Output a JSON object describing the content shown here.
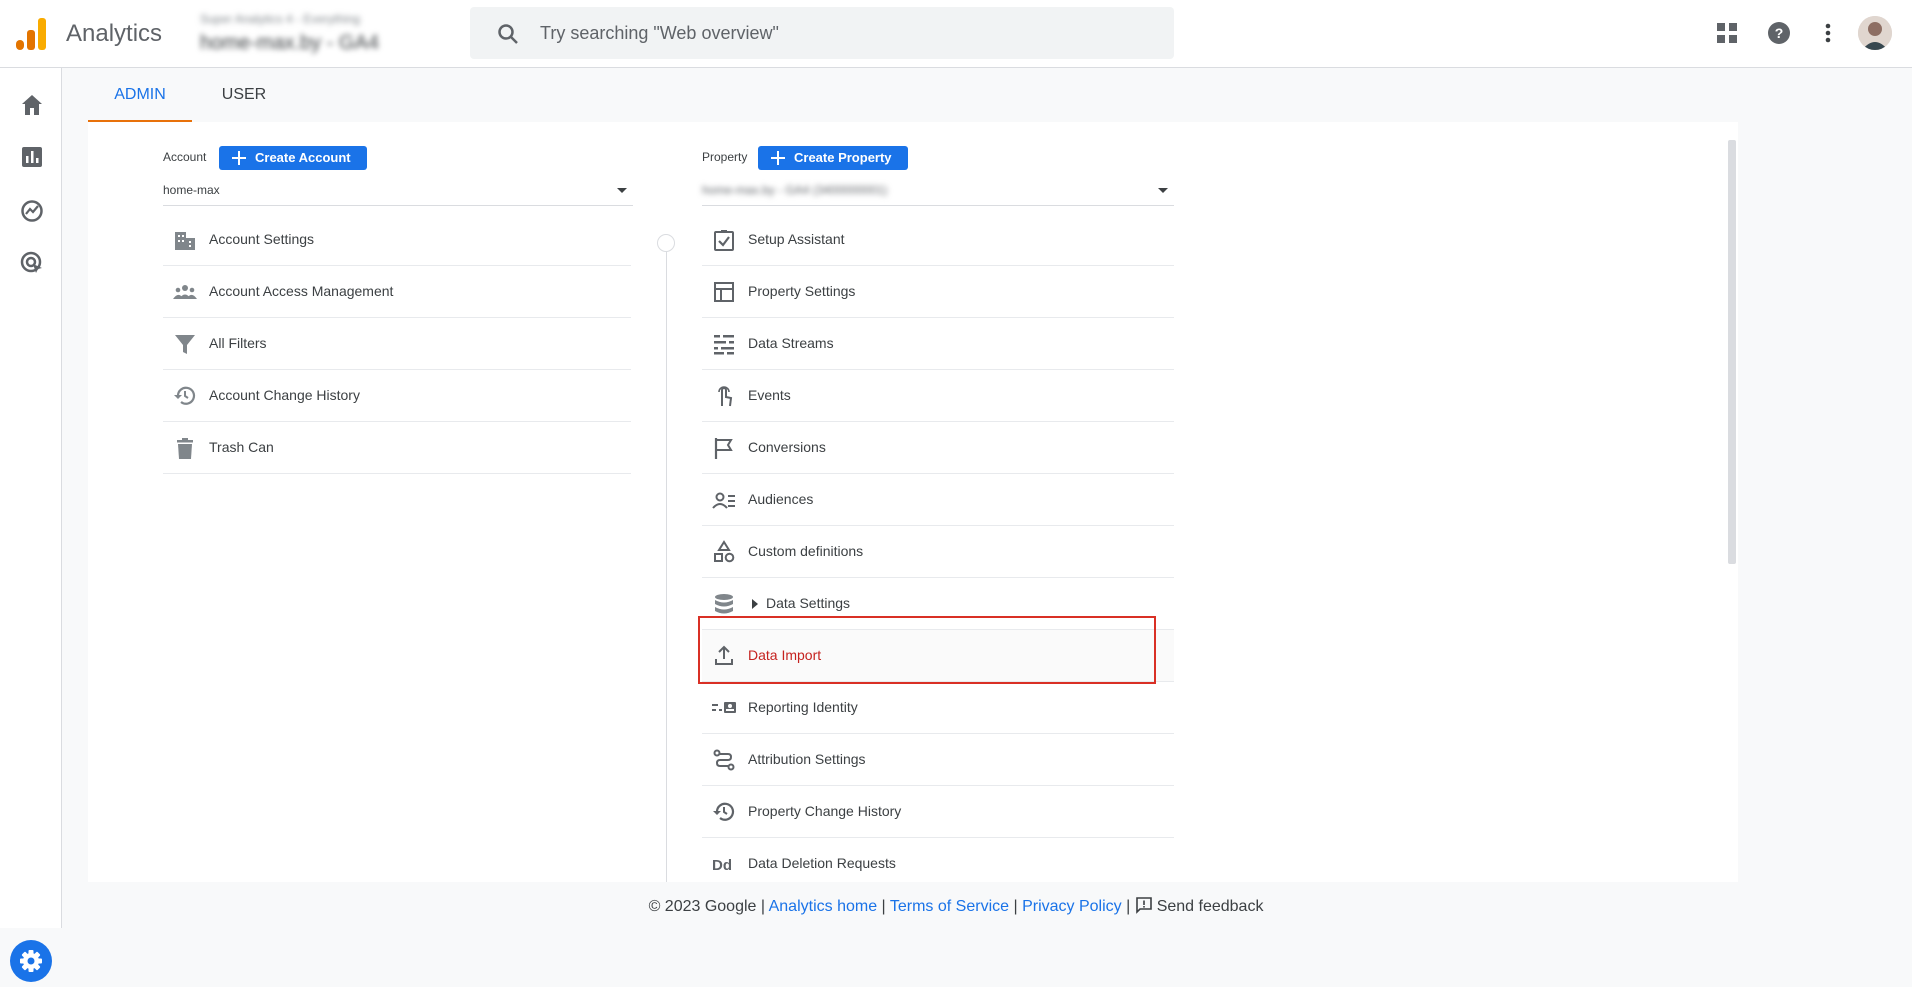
{
  "header": {
    "app_title": "Analytics",
    "property_picker": {
      "line1": "Super Analytics 4 - Everything",
      "line2": "home-max.by - GA4"
    },
    "search_placeholder": "Try searching \"Web overview\""
  },
  "tabs": [
    {
      "label": "ADMIN",
      "active": true
    },
    {
      "label": "USER",
      "active": false
    }
  ],
  "account_column": {
    "label": "Account",
    "create_button": "Create Account",
    "selected": "home-max",
    "items": [
      {
        "label": "Account Settings",
        "icon": "building-icon"
      },
      {
        "label": "Account Access Management",
        "icon": "people-icon"
      },
      {
        "label": "All Filters",
        "icon": "filter-icon"
      },
      {
        "label": "Account Change History",
        "icon": "history-icon"
      },
      {
        "label": "Trash Can",
        "icon": "trash-icon"
      }
    ]
  },
  "property_column": {
    "label": "Property",
    "create_button": "Create Property",
    "selected": "home-max.by - GA4 (3400000001)",
    "items": [
      {
        "label": "Setup Assistant",
        "icon": "checkbox-icon"
      },
      {
        "label": "Property Settings",
        "icon": "layout-icon"
      },
      {
        "label": "Data Streams",
        "icon": "streams-icon"
      },
      {
        "label": "Events",
        "icon": "touch-icon"
      },
      {
        "label": "Conversions",
        "icon": "flag-icon"
      },
      {
        "label": "Audiences",
        "icon": "audience-icon"
      },
      {
        "label": "Custom definitions",
        "icon": "shapes-icon"
      },
      {
        "label": "Data Settings",
        "icon": "database-icon"
      },
      {
        "label": "Data Import",
        "icon": "upload-icon",
        "highlighted": true
      },
      {
        "label": "Reporting Identity",
        "icon": "identity-icon"
      },
      {
        "label": "Attribution Settings",
        "icon": "attribution-icon"
      },
      {
        "label": "Property Change History",
        "icon": "history-icon"
      },
      {
        "label": "Data Deletion Requests",
        "icon": "dd-icon"
      }
    ]
  },
  "footer": {
    "copyright": "© 2023 Google",
    "links": [
      "Analytics home",
      "Terms of Service",
      "Privacy Policy"
    ],
    "feedback": "Send feedback"
  },
  "colors": {
    "accent": "#1a73e8",
    "tab_underline": "#e8710a",
    "highlight": "#d93025",
    "highlight_text": "#c5221f"
  }
}
